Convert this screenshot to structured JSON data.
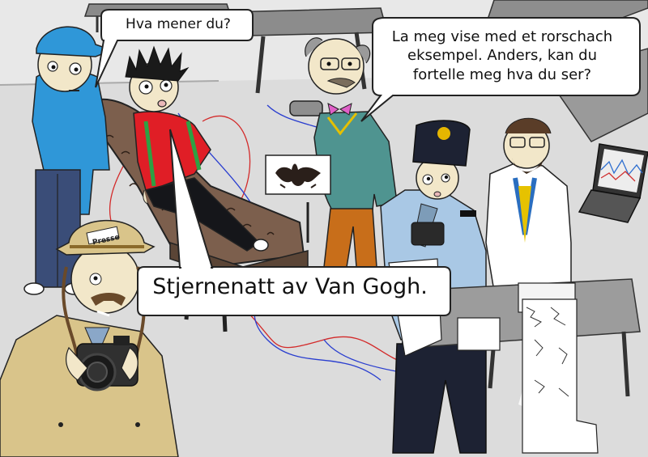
{
  "bubbles": {
    "left_question": "Hva mener du?",
    "doctor_speech": "La meg vise med et rorschach\neksempel. Anders, kan du\nfortelle meg hva du ser?",
    "anders_answer": "Stjernenatt av Van Gogh."
  },
  "press_card": "Presse",
  "colors": {
    "background": "#e6e6e6",
    "floor": "#d9d9d9",
    "blue_shirt": "#2f97d8",
    "red_sweater": "#e01e26",
    "teal_sweater": "#4f9490",
    "police_shirt": "#a9c8e5",
    "police_dark": "#1d2233",
    "trench_coat": "#d9c48a",
    "couch": "#7c5f4d",
    "orange_pants": "#c86e1a",
    "red_shoes": "#e01515"
  }
}
